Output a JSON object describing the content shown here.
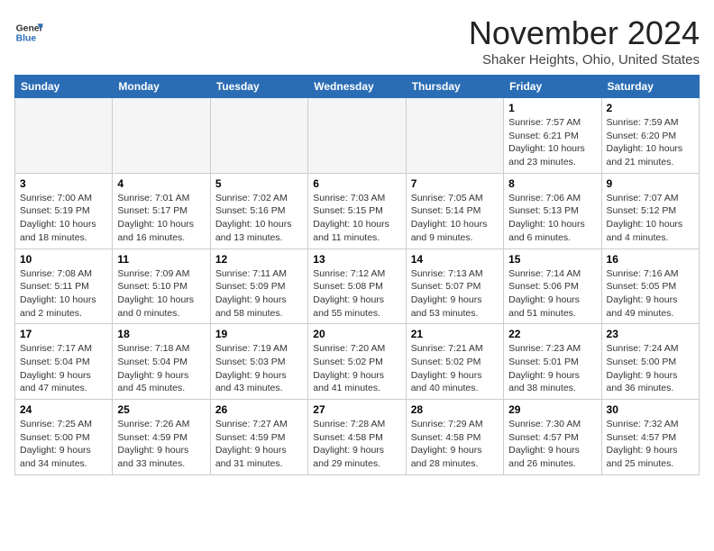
{
  "header": {
    "logo_line1": "General",
    "logo_line2": "Blue",
    "month": "November 2024",
    "location": "Shaker Heights, Ohio, United States"
  },
  "weekdays": [
    "Sunday",
    "Monday",
    "Tuesday",
    "Wednesday",
    "Thursday",
    "Friday",
    "Saturday"
  ],
  "weeks": [
    [
      {
        "day": "",
        "info": ""
      },
      {
        "day": "",
        "info": ""
      },
      {
        "day": "",
        "info": ""
      },
      {
        "day": "",
        "info": ""
      },
      {
        "day": "",
        "info": ""
      },
      {
        "day": "1",
        "info": "Sunrise: 7:57 AM\nSunset: 6:21 PM\nDaylight: 10 hours\nand 23 minutes."
      },
      {
        "day": "2",
        "info": "Sunrise: 7:59 AM\nSunset: 6:20 PM\nDaylight: 10 hours\nand 21 minutes."
      }
    ],
    [
      {
        "day": "3",
        "info": "Sunrise: 7:00 AM\nSunset: 5:19 PM\nDaylight: 10 hours\nand 18 minutes."
      },
      {
        "day": "4",
        "info": "Sunrise: 7:01 AM\nSunset: 5:17 PM\nDaylight: 10 hours\nand 16 minutes."
      },
      {
        "day": "5",
        "info": "Sunrise: 7:02 AM\nSunset: 5:16 PM\nDaylight: 10 hours\nand 13 minutes."
      },
      {
        "day": "6",
        "info": "Sunrise: 7:03 AM\nSunset: 5:15 PM\nDaylight: 10 hours\nand 11 minutes."
      },
      {
        "day": "7",
        "info": "Sunrise: 7:05 AM\nSunset: 5:14 PM\nDaylight: 10 hours\nand 9 minutes."
      },
      {
        "day": "8",
        "info": "Sunrise: 7:06 AM\nSunset: 5:13 PM\nDaylight: 10 hours\nand 6 minutes."
      },
      {
        "day": "9",
        "info": "Sunrise: 7:07 AM\nSunset: 5:12 PM\nDaylight: 10 hours\nand 4 minutes."
      }
    ],
    [
      {
        "day": "10",
        "info": "Sunrise: 7:08 AM\nSunset: 5:11 PM\nDaylight: 10 hours\nand 2 minutes."
      },
      {
        "day": "11",
        "info": "Sunrise: 7:09 AM\nSunset: 5:10 PM\nDaylight: 10 hours\nand 0 minutes."
      },
      {
        "day": "12",
        "info": "Sunrise: 7:11 AM\nSunset: 5:09 PM\nDaylight: 9 hours\nand 58 minutes."
      },
      {
        "day": "13",
        "info": "Sunrise: 7:12 AM\nSunset: 5:08 PM\nDaylight: 9 hours\nand 55 minutes."
      },
      {
        "day": "14",
        "info": "Sunrise: 7:13 AM\nSunset: 5:07 PM\nDaylight: 9 hours\nand 53 minutes."
      },
      {
        "day": "15",
        "info": "Sunrise: 7:14 AM\nSunset: 5:06 PM\nDaylight: 9 hours\nand 51 minutes."
      },
      {
        "day": "16",
        "info": "Sunrise: 7:16 AM\nSunset: 5:05 PM\nDaylight: 9 hours\nand 49 minutes."
      }
    ],
    [
      {
        "day": "17",
        "info": "Sunrise: 7:17 AM\nSunset: 5:04 PM\nDaylight: 9 hours\nand 47 minutes."
      },
      {
        "day": "18",
        "info": "Sunrise: 7:18 AM\nSunset: 5:04 PM\nDaylight: 9 hours\nand 45 minutes."
      },
      {
        "day": "19",
        "info": "Sunrise: 7:19 AM\nSunset: 5:03 PM\nDaylight: 9 hours\nand 43 minutes."
      },
      {
        "day": "20",
        "info": "Sunrise: 7:20 AM\nSunset: 5:02 PM\nDaylight: 9 hours\nand 41 minutes."
      },
      {
        "day": "21",
        "info": "Sunrise: 7:21 AM\nSunset: 5:02 PM\nDaylight: 9 hours\nand 40 minutes."
      },
      {
        "day": "22",
        "info": "Sunrise: 7:23 AM\nSunset: 5:01 PM\nDaylight: 9 hours\nand 38 minutes."
      },
      {
        "day": "23",
        "info": "Sunrise: 7:24 AM\nSunset: 5:00 PM\nDaylight: 9 hours\nand 36 minutes."
      }
    ],
    [
      {
        "day": "24",
        "info": "Sunrise: 7:25 AM\nSunset: 5:00 PM\nDaylight: 9 hours\nand 34 minutes."
      },
      {
        "day": "25",
        "info": "Sunrise: 7:26 AM\nSunset: 4:59 PM\nDaylight: 9 hours\nand 33 minutes."
      },
      {
        "day": "26",
        "info": "Sunrise: 7:27 AM\nSunset: 4:59 PM\nDaylight: 9 hours\nand 31 minutes."
      },
      {
        "day": "27",
        "info": "Sunrise: 7:28 AM\nSunset: 4:58 PM\nDaylight: 9 hours\nand 29 minutes."
      },
      {
        "day": "28",
        "info": "Sunrise: 7:29 AM\nSunset: 4:58 PM\nDaylight: 9 hours\nand 28 minutes."
      },
      {
        "day": "29",
        "info": "Sunrise: 7:30 AM\nSunset: 4:57 PM\nDaylight: 9 hours\nand 26 minutes."
      },
      {
        "day": "30",
        "info": "Sunrise: 7:32 AM\nSunset: 4:57 PM\nDaylight: 9 hours\nand 25 minutes."
      }
    ]
  ]
}
